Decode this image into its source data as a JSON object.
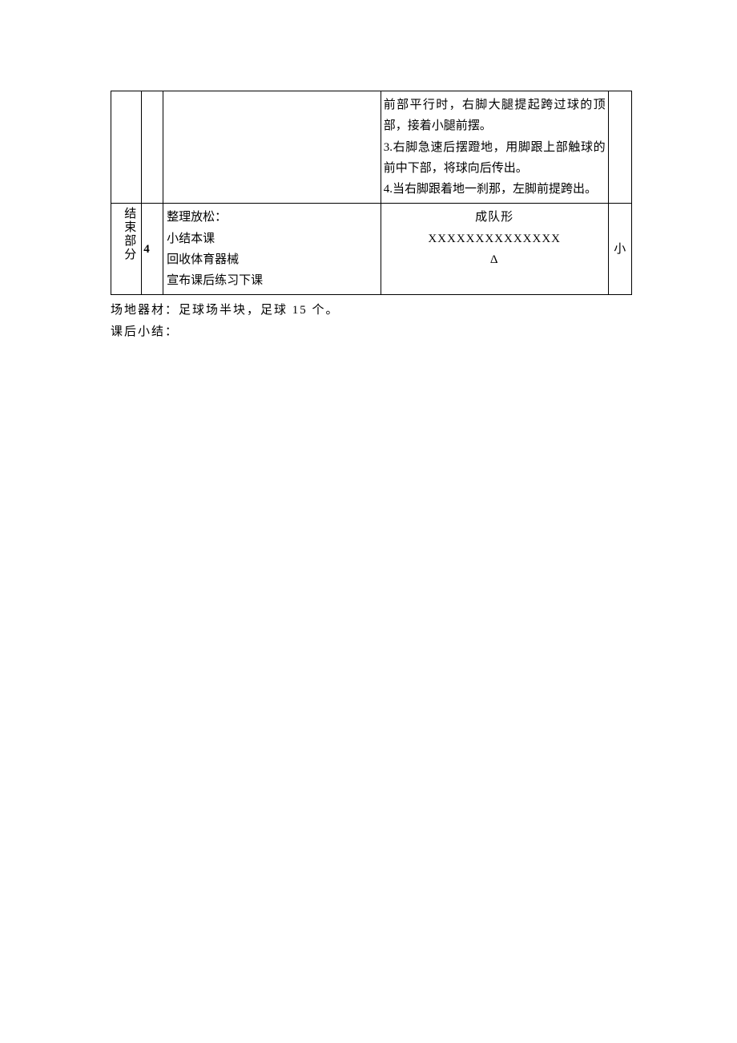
{
  "table": {
    "row1": {
      "section": "",
      "num": "",
      "content": "",
      "org_lines": [
        "前部平行时，右脚大腿提起跨过球的顶部，接着小腿前摆。",
        "3.右脚急速后摆蹬地，用脚跟上部触球的前中下部，将球向后传出。",
        "4.当右脚跟着地一刹那，左脚前提跨出。"
      ],
      "last": ""
    },
    "row2": {
      "section": "结束部分",
      "num": "4",
      "content_lines": [
        "整理放松：",
        "小结本课",
        "回收体育器械",
        "宣布课后练习下课"
      ],
      "org_lines": [
        "成队形",
        "XXXXXXXXXXXXXX",
        "Δ"
      ],
      "last": "小"
    }
  },
  "footer": {
    "line1_label": "场地器材：",
    "line1_value": "足球场半块，足球 15 个。",
    "line2_label": "课后小结："
  }
}
